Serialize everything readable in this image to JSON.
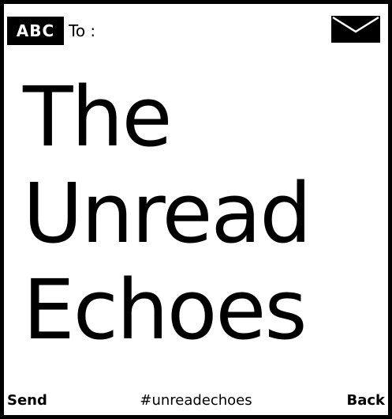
{
  "header": {
    "input_mode": "ABC",
    "to_label": "To :",
    "envelope_icon": "envelope-icon"
  },
  "message": {
    "lines": [
      "The",
      "Unread",
      "Echoes"
    ]
  },
  "softkeys": {
    "left": "Send",
    "center": "#unreadechoes",
    "right": "Back"
  },
  "colors": {
    "background": "#ffffff",
    "foreground": "#000000"
  }
}
